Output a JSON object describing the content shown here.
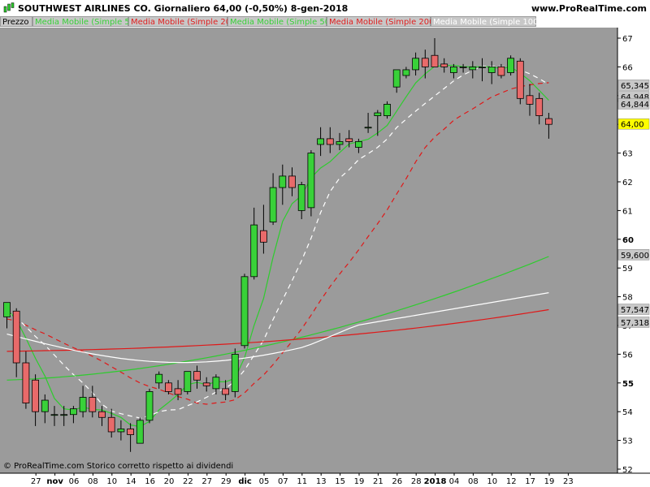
{
  "header": {
    "title": "SOUTHWEST AIRLINES CO.   Giornaliero   64,00 (-0,50%)   8-gen-2018",
    "brand": "www.ProRealTime.com"
  },
  "legend": [
    {
      "label": "Prezzo",
      "color": "#000000"
    },
    {
      "label": "Media Mobile (Simple 5)",
      "color": "#39d139"
    },
    {
      "label": "Media Mobile (Simple 20)",
      "color": "#e02020"
    },
    {
      "label": "Media Mobile (Simple 50)",
      "color": "#39d139"
    },
    {
      "label": "Media Mobile (Simple 200)",
      "color": "#e02020"
    },
    {
      "label": "Media Mobile (Simple 100)",
      "color": "#ffffff"
    },
    {
      "label": "Media Mobile (Simple 10)",
      "color": "#ffffff"
    }
  ],
  "footer": {
    "copyright": "© ProRealTime.com Storico corretto rispetto ai dividendi"
  },
  "colors": {
    "background": "#9b9b9b",
    "up": "#39d139",
    "down": "#e86a6a",
    "ma_green": "#2ecc2e",
    "ma_red": "#e01818",
    "ma_white": "#ffffff"
  },
  "chart_data": {
    "type": "candlestick",
    "ylim": [
      52,
      67.5
    ],
    "y_ticks": [
      {
        "v": 52,
        "label": "52"
      },
      {
        "v": 53,
        "label": "53"
      },
      {
        "v": 54,
        "label": "54"
      },
      {
        "v": 55,
        "label": "55",
        "bold": true
      },
      {
        "v": 56,
        "label": "56"
      },
      {
        "v": 57,
        "label": "57"
      },
      {
        "v": 58,
        "label": "58"
      },
      {
        "v": 59,
        "label": "59"
      },
      {
        "v": 60,
        "label": "60",
        "bold": true
      },
      {
        "v": 61,
        "label": "61"
      },
      {
        "v": 62,
        "label": "62"
      },
      {
        "v": 63,
        "label": "63"
      },
      {
        "v": 64,
        "label": "64"
      },
      {
        "v": 65,
        "label": "65"
      },
      {
        "v": 66,
        "label": "66"
      },
      {
        "v": 67,
        "label": "67"
      }
    ],
    "x_ticks": [
      {
        "i": 1,
        "label": "27"
      },
      {
        "i": 3,
        "label": "nov",
        "bold": true
      },
      {
        "i": 5,
        "label": "06"
      },
      {
        "i": 7,
        "label": "08"
      },
      {
        "i": 9,
        "label": "10"
      },
      {
        "i": 11,
        "label": "14"
      },
      {
        "i": 13,
        "label": "16"
      },
      {
        "i": 15,
        "label": "20"
      },
      {
        "i": 17,
        "label": "22"
      },
      {
        "i": 19,
        "label": "27"
      },
      {
        "i": 21,
        "label": "29"
      },
      {
        "i": 23,
        "label": "dic",
        "bold": true
      },
      {
        "i": 25,
        "label": "05"
      },
      {
        "i": 27,
        "label": "07"
      },
      {
        "i": 29,
        "label": "11"
      },
      {
        "i": 31,
        "label": "13"
      },
      {
        "i": 33,
        "label": "15"
      },
      {
        "i": 35,
        "label": "19"
      },
      {
        "i": 37,
        "label": "21"
      },
      {
        "i": 39,
        "label": "26"
      },
      {
        "i": 41,
        "label": "28"
      },
      {
        "i": 43,
        "label": "2018",
        "bold": true
      },
      {
        "i": 45,
        "label": "04"
      },
      {
        "i": 47,
        "label": "08"
      },
      {
        "i": 49,
        "label": "10"
      },
      {
        "i": 51,
        "label": "12"
      },
      {
        "i": 53,
        "label": "17"
      },
      {
        "i": 55,
        "label": "19"
      },
      {
        "i": 57,
        "label": "23"
      }
    ],
    "candles": [
      {
        "o": 57.3,
        "h": 57.8,
        "l": 56.9,
        "c": 57.8
      },
      {
        "o": 57.5,
        "h": 57.6,
        "l": 55.2,
        "c": 55.7
      },
      {
        "o": 55.7,
        "h": 56.1,
        "l": 54.1,
        "c": 54.3
      },
      {
        "o": 55.1,
        "h": 55.3,
        "l": 53.5,
        "c": 54.0
      },
      {
        "o": 54.0,
        "h": 54.6,
        "l": 53.6,
        "c": 54.4
      },
      {
        "o": 53.9,
        "h": 54.2,
        "l": 53.5,
        "c": 53.9
      },
      {
        "o": 53.9,
        "h": 54.2,
        "l": 53.5,
        "c": 53.9
      },
      {
        "o": 53.9,
        "h": 54.2,
        "l": 53.6,
        "c": 54.1
      },
      {
        "o": 54.0,
        "h": 54.9,
        "l": 53.8,
        "c": 54.5
      },
      {
        "o": 54.5,
        "h": 54.9,
        "l": 53.8,
        "c": 54.0
      },
      {
        "o": 54.0,
        "h": 54.2,
        "l": 53.5,
        "c": 53.8
      },
      {
        "o": 53.8,
        "h": 54.1,
        "l": 53.1,
        "c": 53.3
      },
      {
        "o": 53.3,
        "h": 53.7,
        "l": 53.0,
        "c": 53.4
      },
      {
        "o": 53.4,
        "h": 53.6,
        "l": 52.6,
        "c": 53.2
      },
      {
        "o": 52.9,
        "h": 53.8,
        "l": 52.9,
        "c": 53.7
      },
      {
        "o": 53.7,
        "h": 54.8,
        "l": 53.6,
        "c": 54.7
      },
      {
        "o": 55.0,
        "h": 55.4,
        "l": 54.8,
        "c": 55.3
      },
      {
        "o": 55.0,
        "h": 55.1,
        "l": 54.6,
        "c": 54.7
      },
      {
        "o": 54.8,
        "h": 55.1,
        "l": 54.4,
        "c": 54.6
      },
      {
        "o": 54.7,
        "h": 55.4,
        "l": 54.6,
        "c": 55.4
      },
      {
        "o": 55.4,
        "h": 55.6,
        "l": 54.8,
        "c": 55.1
      },
      {
        "o": 55.0,
        "h": 55.2,
        "l": 54.7,
        "c": 54.9
      },
      {
        "o": 54.8,
        "h": 55.3,
        "l": 54.6,
        "c": 55.2
      },
      {
        "o": 54.8,
        "h": 55.1,
        "l": 54.4,
        "c": 54.6
      },
      {
        "o": 54.7,
        "h": 56.2,
        "l": 54.5,
        "c": 56.0
      },
      {
        "o": 56.3,
        "h": 58.8,
        "l": 56.2,
        "c": 58.7
      },
      {
        "o": 58.7,
        "h": 61.1,
        "l": 58.6,
        "c": 60.5
      },
      {
        "o": 60.3,
        "h": 61.2,
        "l": 59.5,
        "c": 59.9
      },
      {
        "o": 60.6,
        "h": 62.3,
        "l": 60.5,
        "c": 61.8
      },
      {
        "o": 61.8,
        "h": 62.6,
        "l": 61.2,
        "c": 62.2
      },
      {
        "o": 62.2,
        "h": 62.5,
        "l": 61.5,
        "c": 61.8
      },
      {
        "o": 61.0,
        "h": 62.0,
        "l": 60.7,
        "c": 61.9
      },
      {
        "o": 61.1,
        "h": 63.1,
        "l": 60.8,
        "c": 63.0
      },
      {
        "o": 63.3,
        "h": 63.9,
        "l": 62.9,
        "c": 63.5
      },
      {
        "o": 63.5,
        "h": 63.9,
        "l": 63.0,
        "c": 63.3
      },
      {
        "o": 63.3,
        "h": 63.7,
        "l": 63.1,
        "c": 63.4
      },
      {
        "o": 63.5,
        "h": 63.8,
        "l": 63.2,
        "c": 63.4
      },
      {
        "o": 63.2,
        "h": 63.5,
        "l": 63.0,
        "c": 63.4
      },
      {
        "o": 63.9,
        "h": 64.4,
        "l": 63.7,
        "c": 63.9
      },
      {
        "o": 64.3,
        "h": 64.5,
        "l": 63.6,
        "c": 64.4
      },
      {
        "o": 64.3,
        "h": 64.8,
        "l": 64.2,
        "c": 64.7
      },
      {
        "o": 65.3,
        "h": 65.8,
        "l": 65.1,
        "c": 65.9
      },
      {
        "o": 65.7,
        "h": 66.0,
        "l": 65.6,
        "c": 65.9
      },
      {
        "o": 65.9,
        "h": 66.5,
        "l": 65.7,
        "c": 66.3
      },
      {
        "o": 66.3,
        "h": 66.6,
        "l": 65.6,
        "c": 66.0
      },
      {
        "o": 66.4,
        "h": 67.0,
        "l": 66.0,
        "c": 66.0
      },
      {
        "o": 66.1,
        "h": 66.3,
        "l": 65.8,
        "c": 66.0
      },
      {
        "o": 65.8,
        "h": 66.1,
        "l": 65.6,
        "c": 66.0
      },
      {
        "o": 66.0,
        "h": 66.1,
        "l": 65.8,
        "c": 66.0
      },
      {
        "o": 65.9,
        "h": 66.2,
        "l": 65.6,
        "c": 66.0
      },
      {
        "o": 66.0,
        "h": 66.3,
        "l": 65.5,
        "c": 66.0
      },
      {
        "o": 65.8,
        "h": 66.2,
        "l": 65.4,
        "c": 66.0
      },
      {
        "o": 66.0,
        "h": 66.1,
        "l": 65.6,
        "c": 65.7
      },
      {
        "o": 65.8,
        "h": 66.4,
        "l": 65.7,
        "c": 66.3
      },
      {
        "o": 66.2,
        "h": 66.3,
        "l": 64.7,
        "c": 64.9
      },
      {
        "o": 65.0,
        "h": 65.4,
        "l": 64.3,
        "c": 64.7
      },
      {
        "o": 64.9,
        "h": 65.1,
        "l": 64.0,
        "c": 64.3
      },
      {
        "o": 64.2,
        "h": 64.4,
        "l": 63.5,
        "c": 64.0
      }
    ],
    "ma_labels": [
      {
        "label": "65,345",
        "v": 65.35,
        "bg": "#c8c8c8",
        "fg": "#ffffff"
      },
      {
        "label": "64,948",
        "v": 64.95,
        "bg": "#c8c8c8",
        "fg": "#e01818"
      },
      {
        "label": "64,844",
        "v": 64.7,
        "bg": "#c8c8c8",
        "fg": "#2ecc2e"
      },
      {
        "label": "64,00",
        "v": 64.0,
        "bg": "#ffff00",
        "fg": "#000000"
      },
      {
        "label": "59,600",
        "v": 59.45,
        "bg": "#c8c8c8",
        "fg": "#2ecc2e"
      },
      {
        "label": "57,547",
        "v": 57.55,
        "bg": "#c8c8c8",
        "fg": "#e01818"
      },
      {
        "label": "57,318",
        "v": 57.1,
        "bg": "#c8c8c8",
        "fg": "#ffffff"
      }
    ]
  }
}
